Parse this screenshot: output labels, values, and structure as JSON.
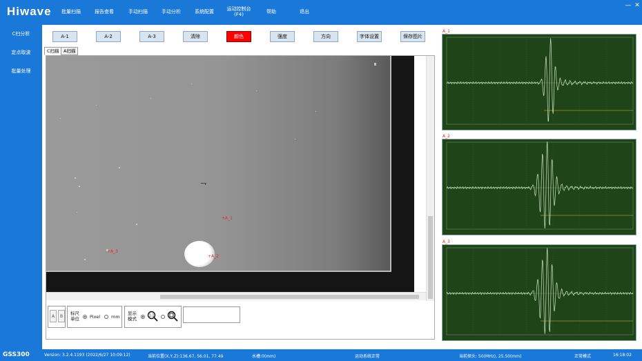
{
  "app": {
    "logo": "Hiwave",
    "product": "GSS300"
  },
  "menu": [
    {
      "label": "批量扫描"
    },
    {
      "label": "报告查看"
    },
    {
      "label": "手动扫描"
    },
    {
      "label": "手动分析"
    },
    {
      "label": "系统配置"
    },
    {
      "label": "运动控制台\n(F4)"
    },
    {
      "label": "帮助"
    },
    {
      "label": "退出"
    }
  ],
  "window_controls": {
    "minimize": "—",
    "close": "✕"
  },
  "sidebar": [
    {
      "label": "C扫分析"
    },
    {
      "label": "定点取波"
    },
    {
      "label": "批量处理"
    }
  ],
  "toolbar": [
    {
      "label": "A-1",
      "active": false
    },
    {
      "label": "A-2",
      "active": false
    },
    {
      "label": "A-3",
      "active": false
    },
    {
      "label": "清除",
      "active": false
    },
    {
      "label": "颜色",
      "active": true
    },
    {
      "label": "强度",
      "active": false
    },
    {
      "label": "方向",
      "active": false
    },
    {
      "label": "字体设置",
      "active": false
    },
    {
      "label": "保存图片",
      "active": false
    }
  ],
  "tabs": [
    {
      "label": "C扫描",
      "active": true
    },
    {
      "label": "A扫描",
      "active": false
    }
  ],
  "image_markers": {
    "a1": "A_1",
    "a2": "A_2",
    "a3": "A_3"
  },
  "bottom_controls": {
    "btn_a": "A",
    "btn_b": "B",
    "ruler_unit_label": "标尺\n单位",
    "unit_options": [
      {
        "label": "Pixel",
        "selected": true
      },
      {
        "label": "mm",
        "selected": false
      }
    ],
    "display_mode_label": "显示\n模式",
    "display_options": [
      {
        "name": "zoom-1to1-icon",
        "selected": true
      },
      {
        "name": "zoom-fit-icon",
        "selected": false
      }
    ]
  },
  "scopes": [
    {
      "title": "A_1"
    },
    {
      "title": "A_2"
    },
    {
      "title": "A_3"
    }
  ],
  "status": {
    "version": "Version: 3.2.4.1193 (2022/6/27 10:09:12)",
    "position": "当前位置(X,Y,Z):136.67, 56.01, 77.49",
    "water": "水槽:0(mm)",
    "motion": "运动系统正常",
    "probe": "当前探头: 50(MHz), 25.50(mm)",
    "mode": "正常模式",
    "time": "16:18:02"
  },
  "colors": {
    "accent_blue": "#1a78d8",
    "active_red": "#ff0000",
    "scope_bg": "#1e4418",
    "marker_red": "#e22222"
  }
}
